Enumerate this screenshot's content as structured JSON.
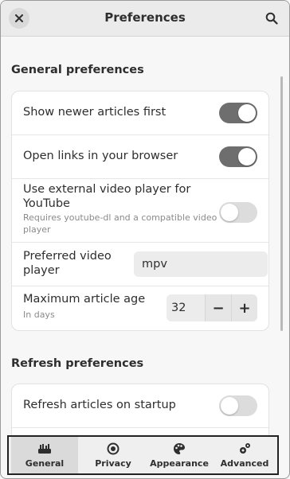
{
  "header": {
    "title": "Preferences"
  },
  "general": {
    "section_title": "General preferences",
    "show_newer": {
      "label": "Show newer articles first",
      "on": true
    },
    "open_links": {
      "label": "Open links in your browser",
      "on": true
    },
    "external_player": {
      "label_line1": "Use external video player for",
      "label_line2": "YouTube",
      "sub_line1": "Requires youtube-dl and a compatible video",
      "sub_line2": "player",
      "on": false
    },
    "preferred_player": {
      "label_line1": "Preferred video",
      "label_line2": "player",
      "value": "mpv"
    },
    "max_age": {
      "label": "Maximum article age",
      "sub": "In days",
      "value": "32",
      "minus": "−",
      "plus": "+"
    }
  },
  "refresh": {
    "section_title": "Refresh preferences",
    "on_startup": {
      "label": "Refresh articles on startup",
      "on": false
    }
  },
  "tabs": [
    {
      "label": "General",
      "icon": "tools-icon",
      "active": true
    },
    {
      "label": "Privacy",
      "icon": "eye-icon",
      "active": false
    },
    {
      "label": "Appearance",
      "icon": "palette-icon",
      "active": false
    },
    {
      "label": "Advanced",
      "icon": "gears-icon",
      "active": false
    }
  ]
}
